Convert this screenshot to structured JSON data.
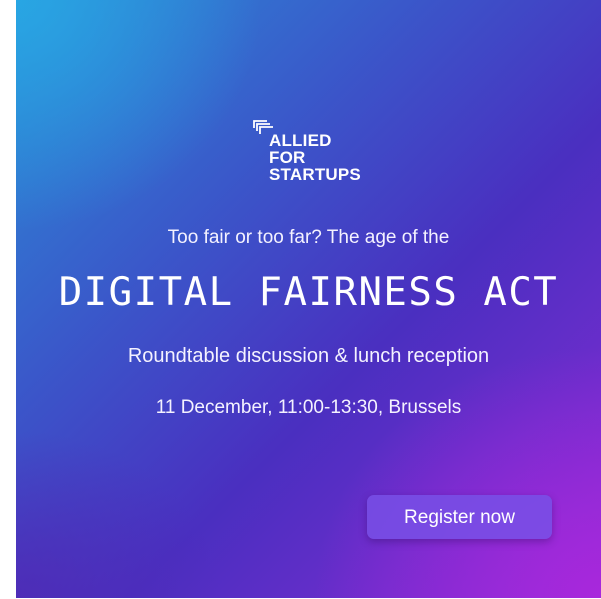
{
  "brand": {
    "logo_lines": [
      "ALLIED",
      "FOR",
      "STARTUPS"
    ]
  },
  "event": {
    "subtitle": "Too fair or too far? The age of the",
    "headline": "DIGITAL FAIRNESS ACT",
    "tagline": "Roundtable discussion & lunch reception",
    "details": "11 December, 11:00-13:30, Brussels"
  },
  "cta": {
    "label": "Register now"
  },
  "colors": {
    "gradient_top_left": "#2a8fd6",
    "gradient_middle": "#4a2fc0",
    "gradient_bottom_right": "#8a2bd6",
    "button": "#7850e6",
    "text": "#ffffff"
  }
}
